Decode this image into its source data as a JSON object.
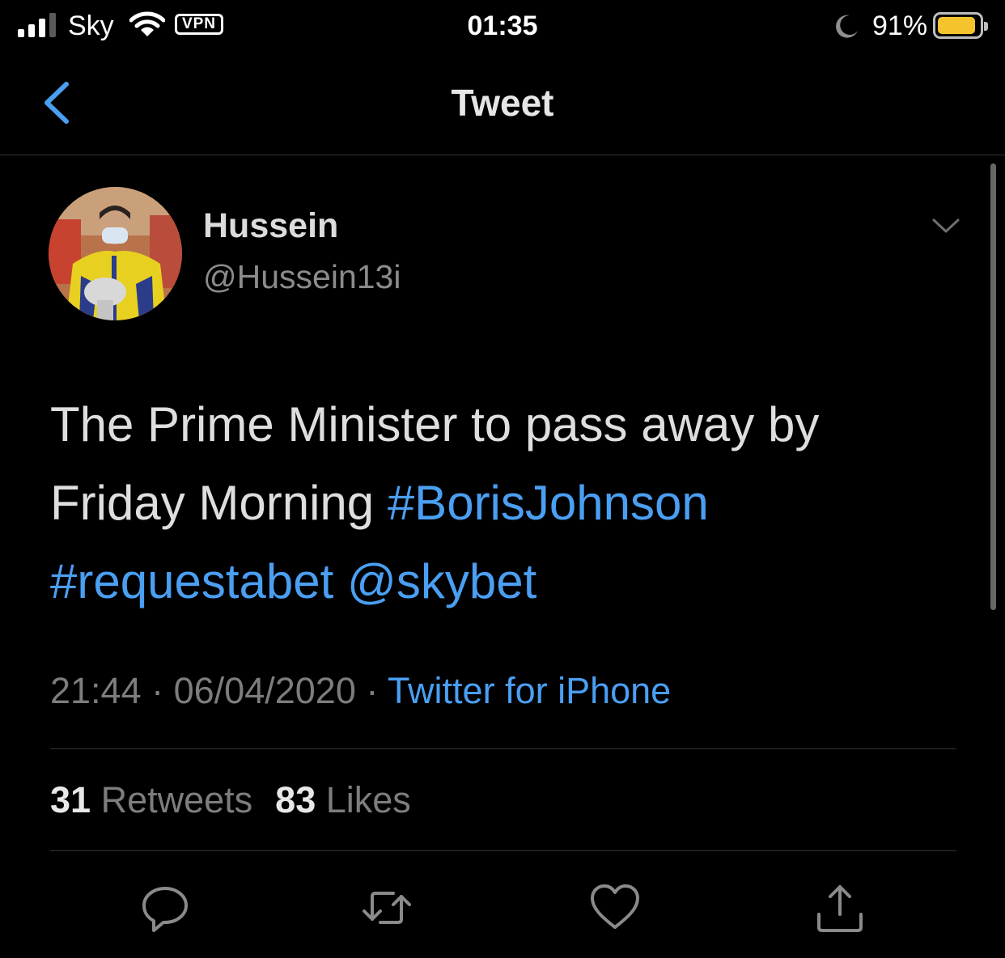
{
  "status_bar": {
    "carrier": "Sky",
    "vpn": "VPN",
    "time": "01:35",
    "battery_percent": "91%",
    "battery_level": 0.91,
    "battery_color": "#f5c42c",
    "icons": [
      "signal-icon",
      "wifi-icon",
      "moon-icon",
      "battery-icon"
    ]
  },
  "nav": {
    "title": "Tweet",
    "back_icon": "chevron-left-icon"
  },
  "tweet": {
    "author_name": "Hussein",
    "author_handle": "@Hussein13i",
    "text_plain_1": "The Prime Minister to pass away by Friday Morning ",
    "hashtag_1": "#BorisJohnson",
    "hashtag_2": "#requestabet",
    "mention": "@skybet",
    "time": "21:44",
    "date": "06/04/2020",
    "separator": " · ",
    "source": "Twitter for iPhone",
    "retweets_count": "31",
    "retweets_label": "Retweets",
    "likes_count": "83",
    "likes_label": "Likes"
  },
  "actions": {
    "reply_icon": "reply-icon",
    "retweet_icon": "retweet-icon",
    "like_icon": "heart-icon",
    "share_icon": "share-icon"
  },
  "colors": {
    "background": "#000000",
    "link": "#4a9ff2",
    "secondary_text": "#7d7d7d"
  }
}
